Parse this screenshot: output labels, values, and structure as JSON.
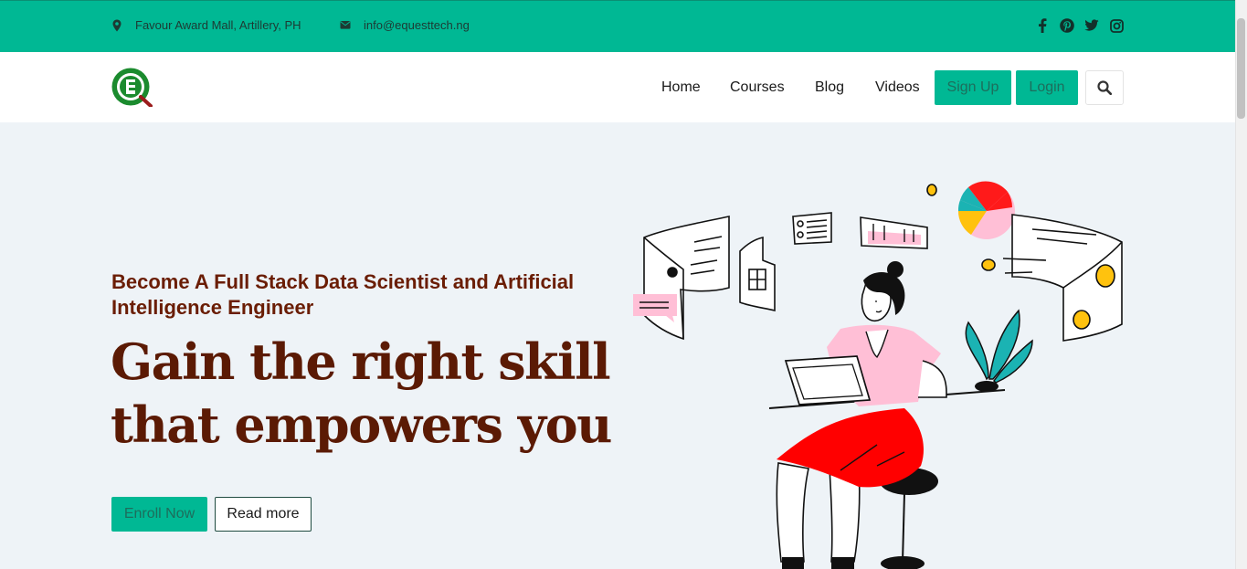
{
  "topbar": {
    "address": "Favour Award Mall, Artillery, PH",
    "email": "info@equesttech.ng",
    "socials": [
      "facebook-icon",
      "pinterest-icon",
      "twitter-icon",
      "instagram-icon"
    ]
  },
  "nav": {
    "items": [
      {
        "label": "Home"
      },
      {
        "label": "Courses"
      },
      {
        "label": "Blog"
      },
      {
        "label": "Videos"
      }
    ],
    "signup_label": "Sign Up",
    "login_label": "Login",
    "search_icon": "search-icon"
  },
  "hero": {
    "subtitle": "Become A Full Stack Data Scientist and Artificial Intelligence Engineer",
    "title": "Gain the right skill that empowers you",
    "enroll_label": "Enroll Now",
    "readmore_label": "Read more"
  },
  "colors": {
    "accent": "#00b894",
    "heading": "#5b1a04",
    "background": "#eef3f7"
  }
}
